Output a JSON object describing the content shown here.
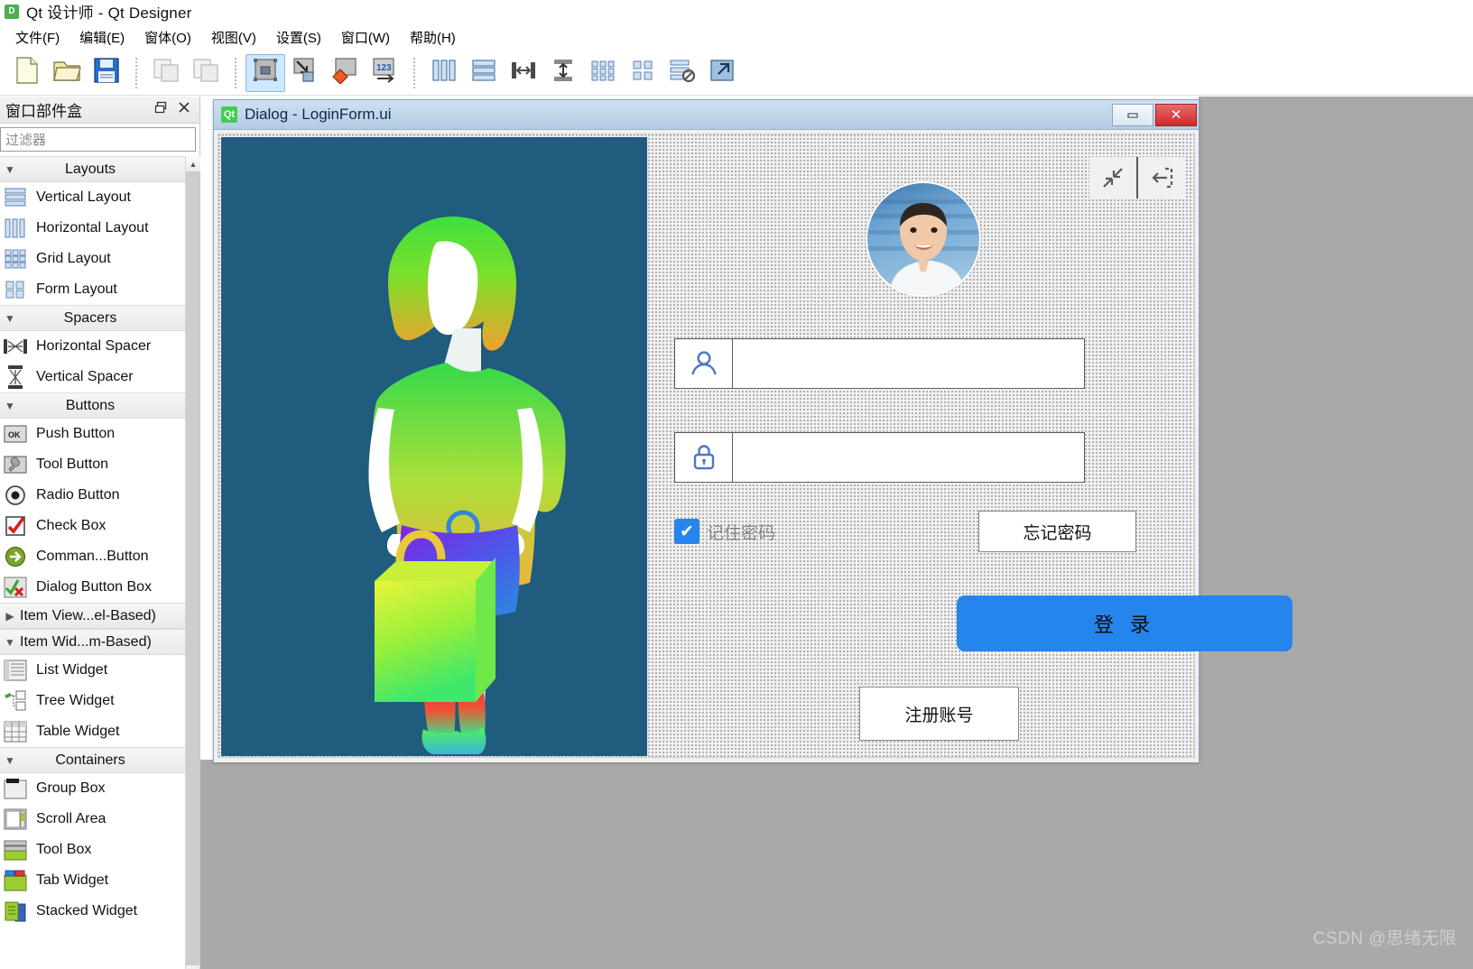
{
  "window": {
    "title": "Qt 设计师 - Qt Designer",
    "app_icon": "D"
  },
  "menubar": {
    "items": [
      {
        "label": "文件(F)",
        "name": "menu-file"
      },
      {
        "label": "编辑(E)",
        "name": "menu-edit"
      },
      {
        "label": "窗体(O)",
        "name": "menu-form"
      },
      {
        "label": "视图(V)",
        "name": "menu-view"
      },
      {
        "label": "设置(S)",
        "name": "menu-settings"
      },
      {
        "label": "窗口(W)",
        "name": "menu-window"
      },
      {
        "label": "帮助(H)",
        "name": "menu-help"
      }
    ]
  },
  "toolbar": {
    "groups": [
      [
        "new-file-icon",
        "open-file-icon",
        "save-file-icon"
      ],
      [
        "undo-icon",
        "redo-icon"
      ],
      [
        "edit-widgets-icon",
        "edit-signals-slots-icon",
        "edit-buddies-icon",
        "edit-tab-order-icon"
      ],
      [
        "layout-horizontally-icon",
        "layout-vertically-icon",
        "layout-splitter-horizontal-icon",
        "layout-splitter-vertical-icon",
        "layout-grid-icon",
        "layout-form-icon",
        "break-layout-icon",
        "adjust-size-icon"
      ]
    ]
  },
  "widget_box": {
    "title": "窗口部件盒",
    "float_button": "float-icon",
    "close_button": "close-icon",
    "filter_placeholder": "过滤器",
    "categories": [
      {
        "label": "Layouts",
        "expanded": true,
        "items": [
          {
            "label": "Vertical Layout",
            "icon": "vertical-layout-icon"
          },
          {
            "label": "Horizontal Layout",
            "icon": "horizontal-layout-icon"
          },
          {
            "label": "Grid Layout",
            "icon": "grid-layout-icon"
          },
          {
            "label": "Form Layout",
            "icon": "form-layout-icon"
          }
        ]
      },
      {
        "label": "Spacers",
        "expanded": true,
        "items": [
          {
            "label": "Horizontal Spacer",
            "icon": "horizontal-spacer-icon"
          },
          {
            "label": "Vertical Spacer",
            "icon": "vertical-spacer-icon"
          }
        ]
      },
      {
        "label": "Buttons",
        "expanded": true,
        "items": [
          {
            "label": "Push Button",
            "icon": "push-button-icon"
          },
          {
            "label": "Tool Button",
            "icon": "tool-button-icon"
          },
          {
            "label": "Radio Button",
            "icon": "radio-button-icon"
          },
          {
            "label": "Check Box",
            "icon": "check-box-icon"
          },
          {
            "label": "Comman...Button",
            "icon": "command-link-button-icon"
          },
          {
            "label": "Dialog Button Box",
            "icon": "dialog-button-box-icon"
          }
        ]
      },
      {
        "label": "Item View...el-Based)",
        "expanded": false,
        "items": []
      },
      {
        "label": "Item Wid...m-Based)",
        "expanded": true,
        "items": [
          {
            "label": "List Widget",
            "icon": "list-widget-icon"
          },
          {
            "label": "Tree Widget",
            "icon": "tree-widget-icon"
          },
          {
            "label": "Table Widget",
            "icon": "table-widget-icon"
          }
        ]
      },
      {
        "label": "Containers",
        "expanded": true,
        "items": [
          {
            "label": "Group Box",
            "icon": "group-box-icon"
          },
          {
            "label": "Scroll Area",
            "icon": "scroll-area-icon"
          },
          {
            "label": "Tool Box",
            "icon": "tool-box-icon"
          },
          {
            "label": "Tab Widget",
            "icon": "tab-widget-icon"
          },
          {
            "label": "Stacked Widget",
            "icon": "stacked-widget-icon"
          }
        ]
      }
    ]
  },
  "dialog": {
    "title": "Dialog - LoginForm.ui",
    "qt_icon": "Qt",
    "minimize_label": "—",
    "close_label": "✕"
  },
  "login_form": {
    "top_icons": [
      {
        "name": "collapse-icon"
      },
      {
        "name": "exit-icon"
      }
    ],
    "avatar": "user-avatar-photo",
    "username": {
      "icon": "person-icon",
      "value": "",
      "placeholder": ""
    },
    "password": {
      "icon": "lock-icon",
      "value": "",
      "placeholder": ""
    },
    "remember": {
      "label": "记住密码",
      "checked": true,
      "check_glyph": "✔"
    },
    "forget_label": "忘记密码",
    "login_label": "登 录",
    "register_label": "注册账号",
    "illustration": "shopping-girl-illustration"
  },
  "colors": {
    "accent_blue": "#2585ec",
    "illustration_bg": "#1f5c7d",
    "titlebar_blue": "#b4cce4",
    "close_red": "#cc2b2b"
  },
  "watermark": {
    "text": "CSDN @思绪无限"
  }
}
